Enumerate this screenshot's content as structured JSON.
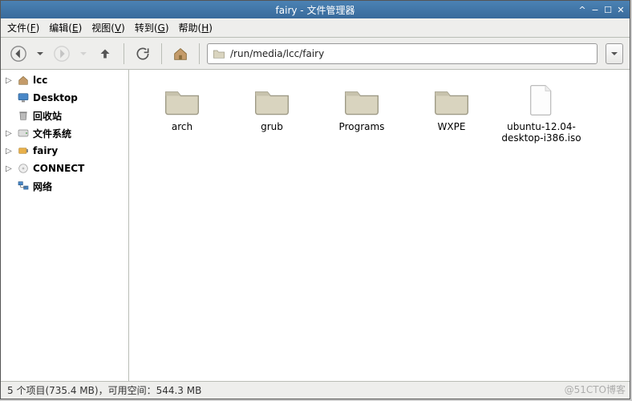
{
  "window": {
    "title": "fairy - 文件管理器"
  },
  "menubar": {
    "file": {
      "label": "文件(",
      "mnemonic": "F",
      "suffix": ")"
    },
    "edit": {
      "label": "编辑(",
      "mnemonic": "E",
      "suffix": ")"
    },
    "view": {
      "label": "视图(",
      "mnemonic": "V",
      "suffix": ")"
    },
    "go": {
      "label": "转到(",
      "mnemonic": "G",
      "suffix": ")"
    },
    "help": {
      "label": "帮助(",
      "mnemonic": "H",
      "suffix": ")"
    }
  },
  "pathbar": {
    "path": "/run/media/lcc/fairy"
  },
  "sidebar": {
    "items": [
      {
        "id": "lcc",
        "label": "lcc",
        "icon": "home-icon",
        "expandable": true
      },
      {
        "id": "desktop",
        "label": "Desktop",
        "icon": "desktop-icon",
        "expandable": false
      },
      {
        "id": "trash",
        "label": "回收站",
        "icon": "trash-icon",
        "expandable": false
      },
      {
        "id": "fs",
        "label": "文件系统",
        "icon": "disk-icon",
        "expandable": true
      },
      {
        "id": "fairy",
        "label": "fairy",
        "icon": "usb-icon",
        "expandable": true
      },
      {
        "id": "connect",
        "label": "CONNECT",
        "icon": "cdrom-icon",
        "expandable": true
      },
      {
        "id": "network",
        "label": "网络",
        "icon": "network-icon",
        "expandable": false
      }
    ]
  },
  "content": {
    "items": [
      {
        "name": "arch",
        "type": "folder"
      },
      {
        "name": "grub",
        "type": "folder"
      },
      {
        "name": "Programs",
        "type": "folder"
      },
      {
        "name": "WXPE",
        "type": "folder"
      },
      {
        "name": "ubuntu-12.04-desktop-i386.iso",
        "type": "file"
      }
    ]
  },
  "statusbar": {
    "text": "5 个项目(735.4 MB)，可用空间：544.3 MB"
  },
  "watermark": "@51CTO博客"
}
